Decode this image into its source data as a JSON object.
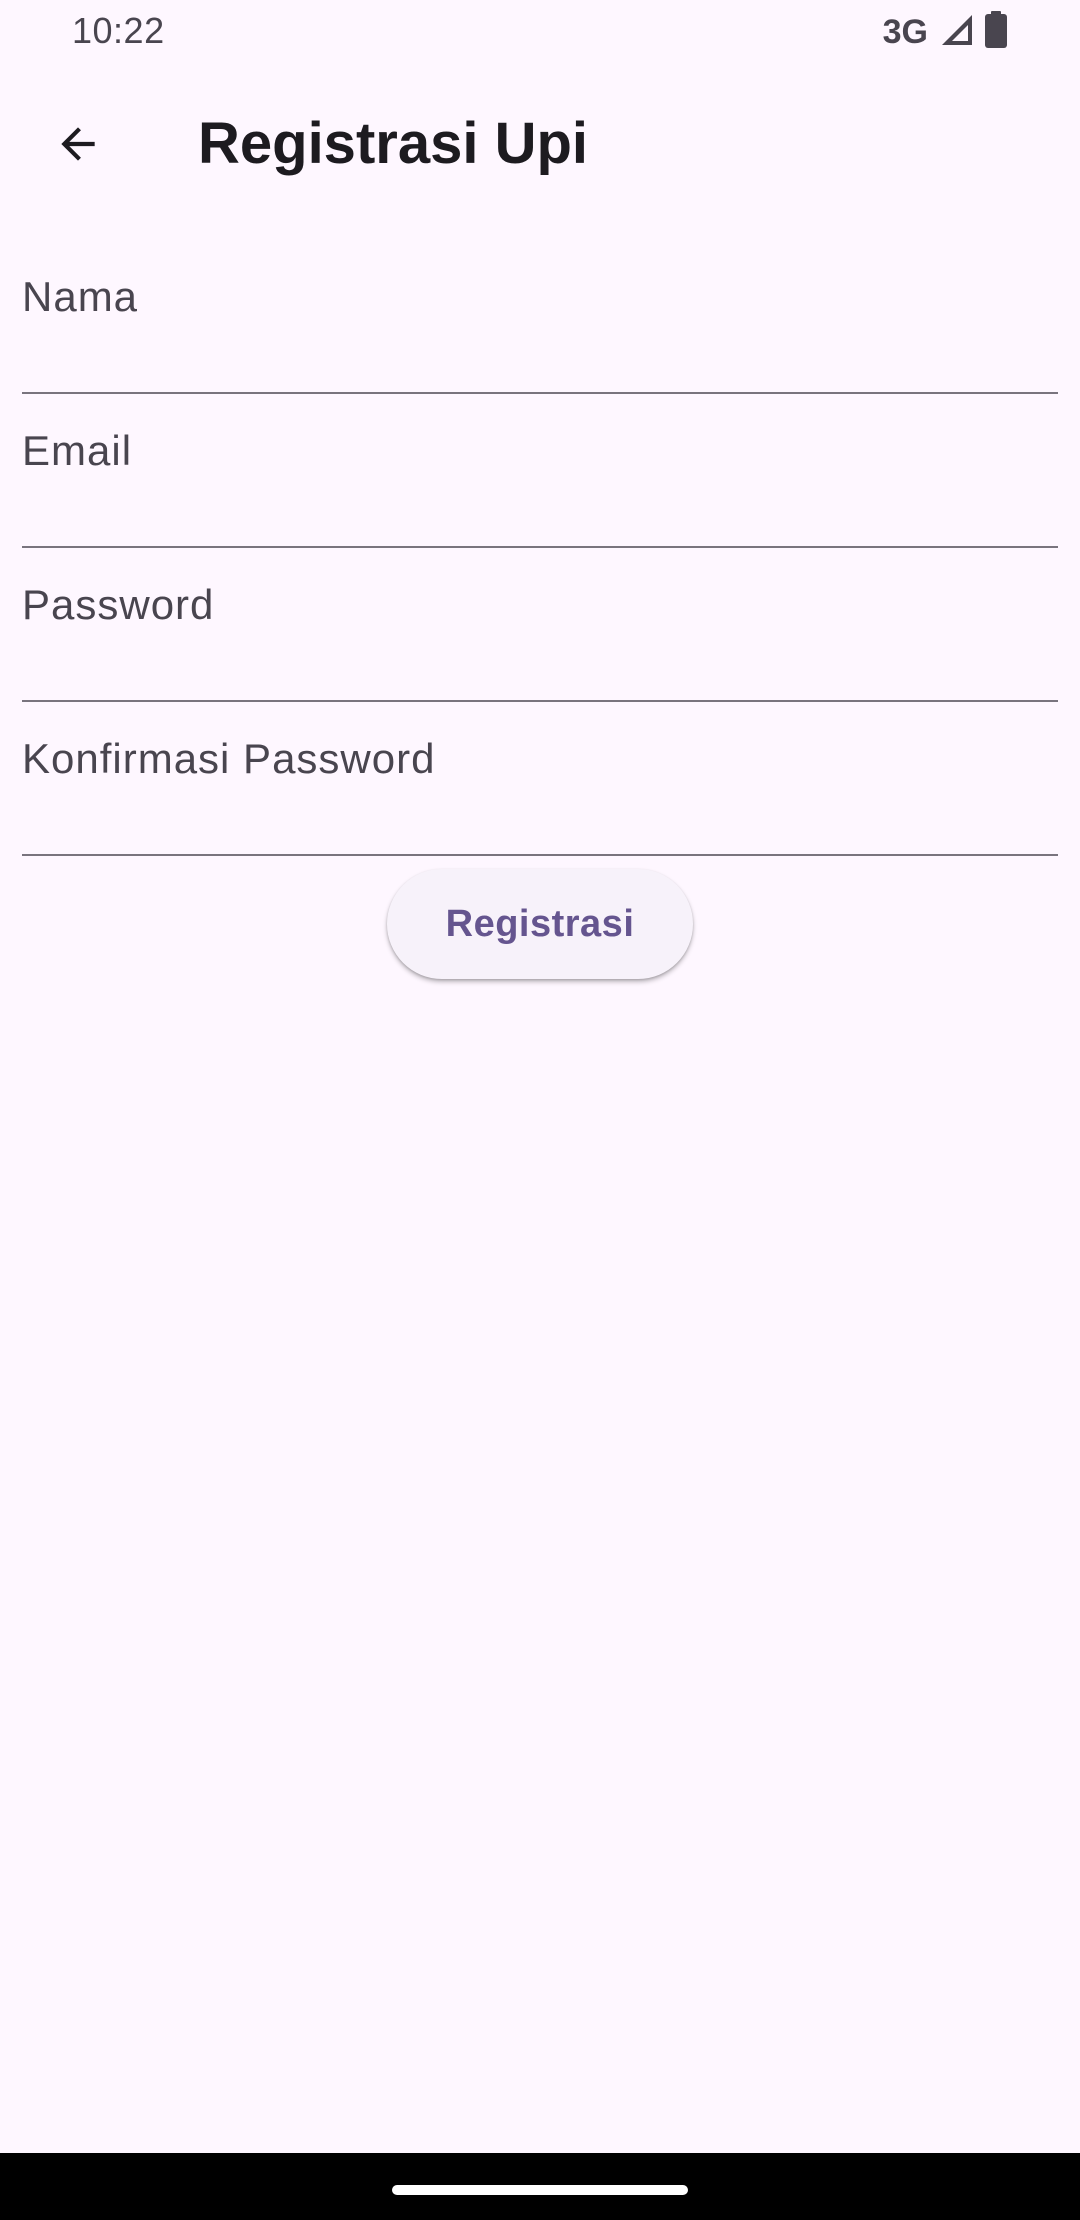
{
  "status_bar": {
    "time": "10:22",
    "network": "3G",
    "signal_icon": "cellular-signal-icon",
    "battery_icon": "battery-icon"
  },
  "app_bar": {
    "back_icon": "arrow-back-icon",
    "title": "Registrasi Upi"
  },
  "form": {
    "nama": {
      "value": "",
      "placeholder": "Nama"
    },
    "email": {
      "value": "",
      "placeholder": "Email"
    },
    "password": {
      "value": "",
      "placeholder": "Password"
    },
    "confirm_password": {
      "value": "",
      "placeholder": "Konfirmasi Password"
    },
    "submit_label": "Registrasi"
  },
  "colors": {
    "background": "#FEF7FF",
    "primary": "#65558F",
    "on_surface": "#1D1B20",
    "on_surface_variant": "#49454F",
    "outline": "#79747E",
    "button_surface": "#F7F2FA"
  },
  "nav_bar": {
    "home_handle": "home-gesture-handle"
  }
}
